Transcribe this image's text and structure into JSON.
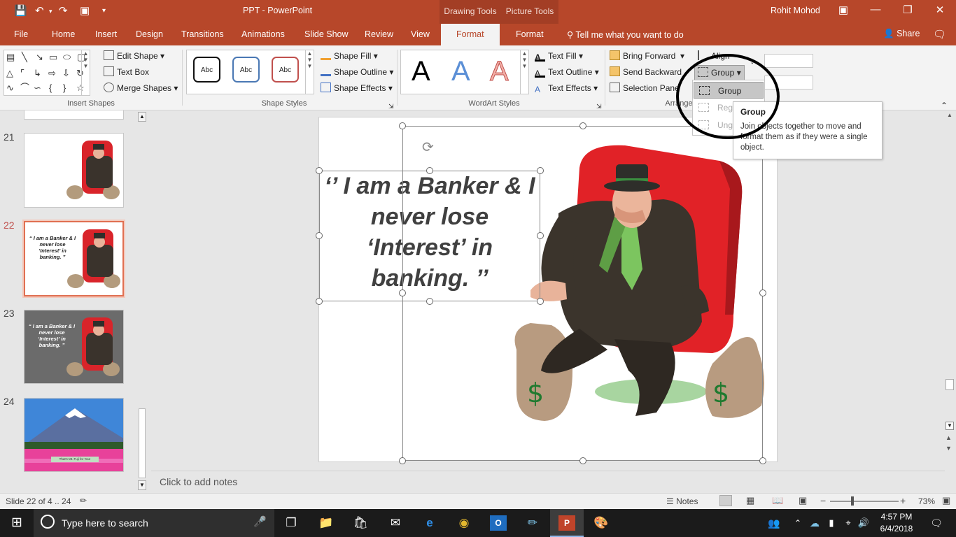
{
  "title_bar": {
    "document_title": "PPT  -  PowerPoint",
    "context_tabs": [
      "Drawing Tools",
      "Picture Tools"
    ],
    "user_name": "Rohit Mohod"
  },
  "tabs": [
    "File",
    "Home",
    "Insert",
    "Design",
    "Transitions",
    "Animations",
    "Slide Show",
    "Review",
    "View",
    "Format",
    "Format"
  ],
  "tell_me": "Tell me what you want to do",
  "share": "Share",
  "ribbon": {
    "insert_shapes": {
      "edit_shape": "Edit Shape",
      "text_box": "Text Box",
      "merge_shapes": "Merge Shapes",
      "label": "Insert Shapes"
    },
    "shape_styles": {
      "samples": [
        "Abc",
        "Abc",
        "Abc"
      ],
      "shape_fill": "Shape Fill",
      "shape_outline": "Shape Outline",
      "shape_effects": "Shape Effects",
      "label": "Shape Styles"
    },
    "wordart": {
      "samples": [
        "A",
        "A",
        "A"
      ],
      "text_fill": "Text Fill",
      "text_outline": "Text Outline",
      "text_effects": "Text Effects",
      "label": "WordArt Styles"
    },
    "arrange": {
      "bring_forward": "Bring Forward",
      "send_backward": "Send Backward",
      "selection_pane": "Selection Pane",
      "align": "Align",
      "group": "Group",
      "label": "Arrange"
    }
  },
  "group_menu": {
    "items": [
      "Group",
      "Regroup",
      "Ungroup"
    ],
    "items_visible": [
      "Group",
      "Reg",
      "Ung"
    ]
  },
  "tooltip": {
    "title": "Group",
    "body": "Join objects together to move and format them as if they were a single object."
  },
  "thumbnails": [
    {
      "number": "21"
    },
    {
      "number": "22",
      "text": "“ I am a Banker & I never lose ‘Interest’ in banking. ”"
    },
    {
      "number": "23",
      "text": "“ I am a Banker & I never lose ‘Interest’ in banking. ”"
    },
    {
      "number": "24",
      "caption": "That's Mt. Fuji for You!"
    }
  ],
  "slide": {
    "quote": "‘’ I am a Banker & I never lose ‘Interest’ in banking. ’’"
  },
  "notes_placeholder": "Click to add notes",
  "status": {
    "slide_info": "Slide 22 of 4 .. 24",
    "notes": "Notes",
    "zoom": "73%"
  },
  "taskbar": {
    "search_placeholder": "Type here to search",
    "time": "4:57 PM",
    "date": "6/4/2018"
  },
  "colors": {
    "accent": "#b7472a",
    "selected_thumb": "#e07052"
  }
}
